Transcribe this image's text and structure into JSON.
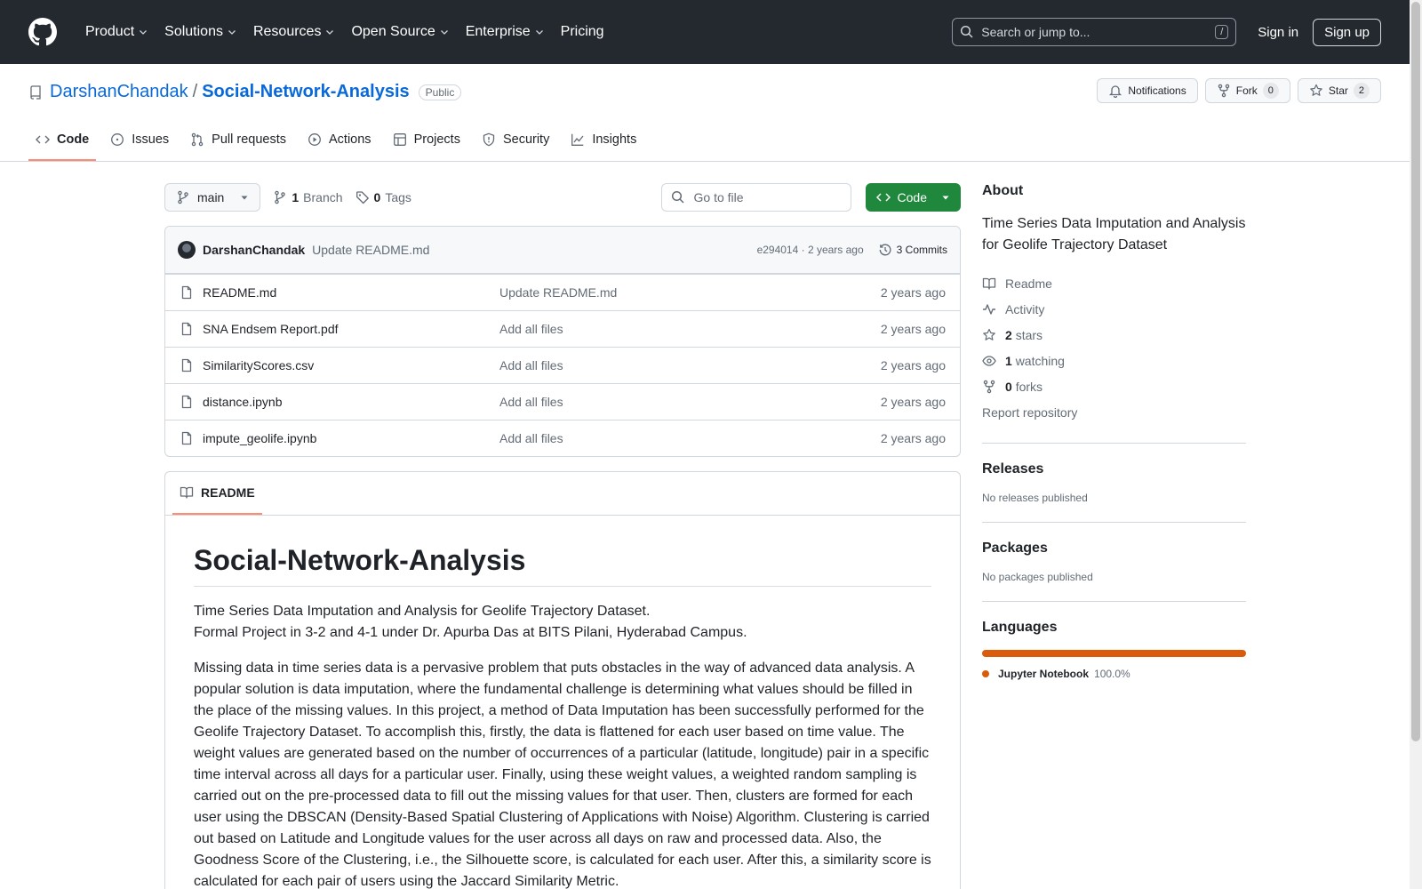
{
  "header": {
    "nav": [
      "Product",
      "Solutions",
      "Resources",
      "Open Source",
      "Enterprise",
      "Pricing"
    ],
    "search_placeholder": "Search or jump to...",
    "search_key": "/",
    "sign_in": "Sign in",
    "sign_up": "Sign up"
  },
  "repo": {
    "owner": "DarshanChandak",
    "separator": "/",
    "name": "Social-Network-Analysis",
    "visibility": "Public",
    "notifications_label": "Notifications",
    "fork_label": "Fork",
    "fork_count": "0",
    "star_label": "Star",
    "star_count": "2"
  },
  "tabs": [
    {
      "label": "Code",
      "icon": "code-icon",
      "active": true
    },
    {
      "label": "Issues",
      "icon": "issue-icon"
    },
    {
      "label": "Pull requests",
      "icon": "pull-request-icon"
    },
    {
      "label": "Actions",
      "icon": "play-icon"
    },
    {
      "label": "Projects",
      "icon": "table-icon"
    },
    {
      "label": "Security",
      "icon": "shield-icon"
    },
    {
      "label": "Insights",
      "icon": "graph-icon"
    }
  ],
  "toolbar": {
    "branch": "main",
    "branch_count": "1",
    "branch_word": "Branch",
    "tag_count": "0",
    "tag_word": "Tags",
    "goto_placeholder": "Go to file",
    "code_button": "Code"
  },
  "commit": {
    "author": "DarshanChandak",
    "message": "Update README.md",
    "sha_time": "e294014 · 2 years ago",
    "commits": "3 Commits"
  },
  "files": [
    {
      "name": "README.md",
      "message": "Update README.md",
      "date": "2 years ago"
    },
    {
      "name": "SNA Endsem Report.pdf",
      "message": "Add all files",
      "date": "2 years ago"
    },
    {
      "name": "SimilarityScores.csv",
      "message": "Add all files",
      "date": "2 years ago"
    },
    {
      "name": "distance.ipynb",
      "message": "Add all files",
      "date": "2 years ago"
    },
    {
      "name": "impute_geolife.ipynb",
      "message": "Add all files",
      "date": "2 years ago"
    }
  ],
  "readme": {
    "tab_label": "README",
    "title": "Social-Network-Analysis",
    "line1": "Time Series Data Imputation and Analysis for Geolife Trajectory Dataset.",
    "line2": "Formal Project in 3-2 and 4-1 under Dr. Apurba Das at BITS Pilani, Hyderabad Campus.",
    "paragraph": "Missing data in time series data is a pervasive problem that puts obstacles in the way of advanced data analysis. A popular solution is data imputation, where the fundamental challenge is determining what values should be filled in the place of the missing values. In this project, a method of Data Imputation has been successfully performed for the Geolife Trajectory Dataset. To accomplish this, firstly, the data is flattened for each user based on time value. The weight values are generated based on the number of occurrences of a particular (latitude, longitude) pair in a specific time interval across all days for a particular user. Finally, using these weight values, a weighted random sampling is carried out on the pre-processed data to fill out the missing values for that user. Then, clusters are formed for each user using the DBSCAN (Density-Based Spatial Clustering of Applications with Noise) Algorithm. Clustering is carried out based on Latitude and Longitude values for the user across all days on raw and processed data. Also, the Goodness Score of the Clustering, i.e., the Silhouette score, is calculated for each user. After this, a similarity score is calculated for each pair of users using the Jaccard Similarity Metric."
  },
  "about": {
    "heading": "About",
    "description": "Time Series Data Imputation and Analysis for Geolife Trajectory Dataset",
    "readme": "Readme",
    "activity": "Activity",
    "stars_count": "2",
    "stars_word": "stars",
    "watching_count": "1",
    "watching_word": "watching",
    "forks_count": "0",
    "forks_word": "forks",
    "report": "Report repository"
  },
  "releases": {
    "heading": "Releases",
    "empty": "No releases published"
  },
  "packages": {
    "heading": "Packages",
    "empty": "No packages published"
  },
  "languages": {
    "heading": "Languages",
    "name": "Jupyter Notebook",
    "percent": "100.0%",
    "color": "#da5b0b"
  }
}
